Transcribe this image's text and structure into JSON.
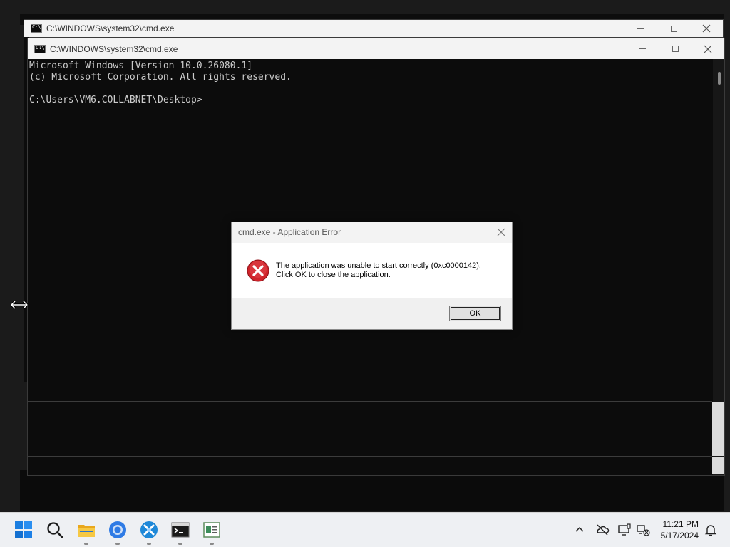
{
  "back_window": {
    "title": "C:\\WINDOWS\\system32\\cmd.exe"
  },
  "front_window": {
    "title": "C:\\WINDOWS\\system32\\cmd.exe",
    "console_lines": [
      "Microsoft Windows [Version 10.0.26080.1]",
      "(c) Microsoft Corporation. All rights reserved.",
      "",
      "C:\\Users\\VM6.COLLABNET\\Desktop>"
    ]
  },
  "error_dialog": {
    "title": "cmd.exe - Application Error",
    "message_line1": "The application was unable to start correctly (0xc0000142).",
    "message_line2": "Click OK to close the application.",
    "ok_label": "OK",
    "icon": "error-icon"
  },
  "taskbar": {
    "pinned": [
      "start-icon",
      "search-icon",
      "file-explorer-icon",
      "chrome-icon",
      "app-icon",
      "terminal-icon",
      "notepad-icon"
    ],
    "tray": [
      "chevron-up-icon",
      "onedrive-icon",
      "display-icon",
      "network-icon"
    ],
    "time": "11:21 PM",
    "date": "5/17/2024"
  },
  "colors": {
    "console_bg": "#0c0c0c",
    "console_fg": "#cccccc",
    "error_red": "#d0232a"
  }
}
